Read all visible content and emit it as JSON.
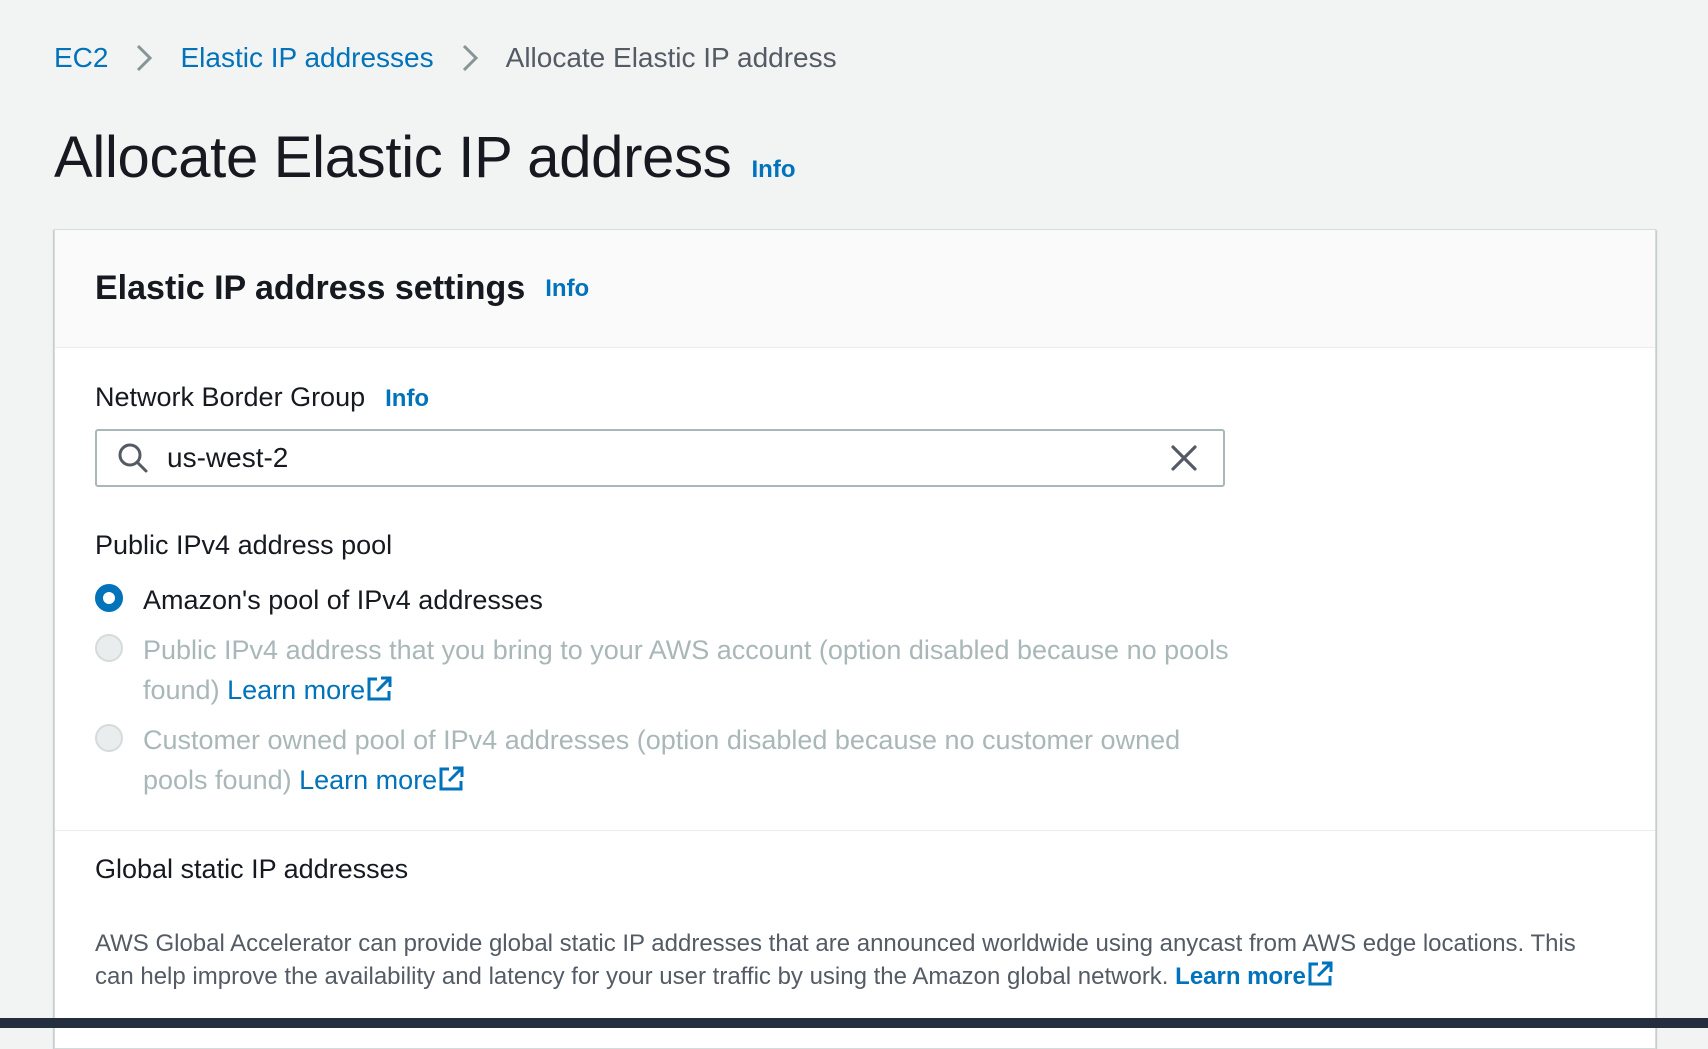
{
  "breadcrumb": {
    "items": [
      "EC2",
      "Elastic IP addresses"
    ],
    "current": "Allocate Elastic IP address"
  },
  "page": {
    "title": "Allocate Elastic IP address",
    "info": "Info"
  },
  "settings": {
    "title": "Elastic IP address settings",
    "info": "Info",
    "network_border_group": {
      "label": "Network Border Group",
      "info": "Info",
      "value": "us-west-2"
    },
    "ipv4_pool": {
      "label": "Public IPv4 address pool",
      "options": [
        {
          "label": "Amazon's pool of IPv4 addresses",
          "selected": true,
          "disabled": false
        },
        {
          "label": "Public IPv4 address that you bring to your AWS account (option disabled because no pools found)",
          "link": "Learn more",
          "selected": false,
          "disabled": true
        },
        {
          "label": "Customer owned pool of IPv4 addresses (option disabled because no customer owned pools found)",
          "link": "Learn more",
          "selected": false,
          "disabled": true
        }
      ]
    },
    "global_static": {
      "title": "Global static IP addresses",
      "description": "AWS Global Accelerator can provide global static IP addresses that are announced worldwide using anycast from AWS edge locations. This can help improve the availability and latency for your user traffic by using the Amazon global network.",
      "link": "Learn more"
    }
  },
  "colors": {
    "link": "#0073bb",
    "text": "#16191f",
    "muted": "#aab7b8",
    "background": "#f2f3f3"
  }
}
